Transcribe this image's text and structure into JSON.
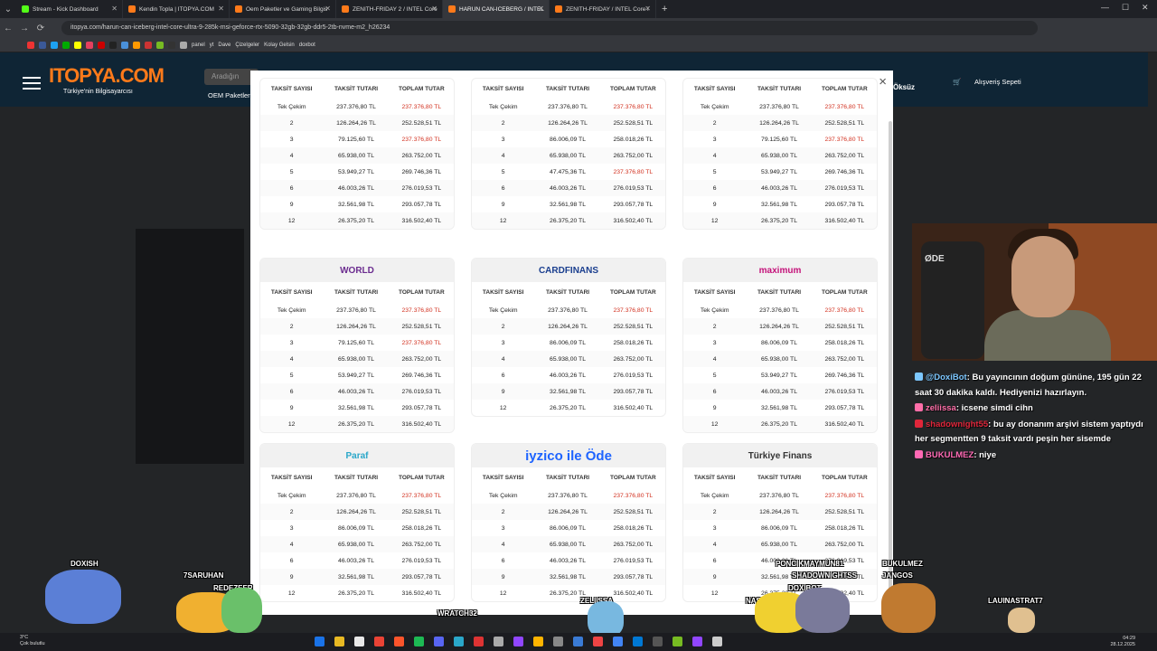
{
  "browser": {
    "tabs": [
      {
        "title": "Stream - Kick Dashboard",
        "color": "#53fc18",
        "active": false
      },
      {
        "title": "Kendin Topla | ITOPYA.COM",
        "color": "#ff7a1a",
        "active": false
      },
      {
        "title": "Oem Paketler ve Gaming Bilgis",
        "color": "#ff7a1a",
        "active": false
      },
      {
        "title": "ZENITH-FRIDAY 2 / INTEL Core",
        "color": "#ff7a1a",
        "active": false
      },
      {
        "title": "HARUN CAN-ICEBERG / INTEL",
        "color": "#ff7a1a",
        "active": true
      },
      {
        "title": "ZENITH-FRIDAY / INTEL Core i",
        "color": "#ff7a1a",
        "active": false
      }
    ],
    "url": "itopya.com/harun-can-iceberg-intel-core-ultra-9-285k-msi-geforce-rtx-5090-32gb-32gb-ddr5-2tb-nvme-m2_h26234",
    "bookmarks": [
      "panel",
      "yt",
      "Dave",
      "Çizelgeler",
      "Kolay Gelsin",
      "doxbot"
    ]
  },
  "site": {
    "logo": "ITOPYA.COM",
    "slogan": "Türkiye'nin Bilgisayarcısı",
    "search_placeholder": "Aradığın",
    "oem_label": "OEM Paketler",
    "user_label": "Öksüz",
    "cart_count": "0",
    "cart_label": "Alışveriş Sepeti"
  },
  "modal": {
    "close_label": "×",
    "headers": {
      "count": "TAKSİT SAYISI",
      "installment": "TAKSİT TUTARI",
      "total": "TOPLAM TUTAR"
    },
    "cards": [
      {
        "bank": "",
        "brand_color": "#333",
        "rows": [
          [
            "Tek Çekim",
            "237.376,80 TL",
            "237.376,80 TL",
            true
          ],
          [
            "2",
            "126.264,26 TL",
            "252.528,51 TL",
            false
          ],
          [
            "3",
            "79.125,60 TL",
            "237.376,80 TL",
            true
          ],
          [
            "4",
            "65.938,00 TL",
            "263.752,00 TL",
            false
          ],
          [
            "5",
            "53.949,27 TL",
            "269.746,36 TL",
            false
          ],
          [
            "6",
            "46.003,26 TL",
            "276.019,53 TL",
            false
          ],
          [
            "9",
            "32.561,98 TL",
            "293.057,78 TL",
            false
          ],
          [
            "12",
            "26.375,20 TL",
            "316.502,40 TL",
            false
          ]
        ]
      },
      {
        "bank": "",
        "brand_color": "#333",
        "rows": [
          [
            "Tek Çekim",
            "237.376,80 TL",
            "237.376,80 TL",
            true
          ],
          [
            "2",
            "126.264,26 TL",
            "252.528,51 TL",
            false
          ],
          [
            "3",
            "86.006,09 TL",
            "258.018,26 TL",
            false
          ],
          [
            "4",
            "65.938,00 TL",
            "263.752,00 TL",
            false
          ],
          [
            "5",
            "47.475,36 TL",
            "237.376,80 TL",
            true
          ],
          [
            "6",
            "46.003,26 TL",
            "276.019,53 TL",
            false
          ],
          [
            "9",
            "32.561,98 TL",
            "293.057,78 TL",
            false
          ],
          [
            "12",
            "26.375,20 TL",
            "316.502,40 TL",
            false
          ]
        ]
      },
      {
        "bank": "",
        "brand_color": "#333",
        "rows": [
          [
            "Tek Çekim",
            "237.376,80 TL",
            "237.376,80 TL",
            true
          ],
          [
            "2",
            "126.264,26 TL",
            "252.528,51 TL",
            false
          ],
          [
            "3",
            "79.125,60 TL",
            "237.376,80 TL",
            true
          ],
          [
            "4",
            "65.938,00 TL",
            "263.752,00 TL",
            false
          ],
          [
            "5",
            "53.949,27 TL",
            "269.746,36 TL",
            false
          ],
          [
            "6",
            "46.003,26 TL",
            "276.019,53 TL",
            false
          ],
          [
            "9",
            "32.561,98 TL",
            "293.057,78 TL",
            false
          ],
          [
            "12",
            "26.375,20 TL",
            "316.502,40 TL",
            false
          ]
        ]
      },
      {
        "bank": "WORLD",
        "brand_color": "#6b2c8f",
        "rows": [
          [
            "Tek Çekim",
            "237.376,80 TL",
            "237.376,80 TL",
            true
          ],
          [
            "2",
            "126.264,26 TL",
            "252.528,51 TL",
            false
          ],
          [
            "3",
            "79.125,60 TL",
            "237.376,80 TL",
            true
          ],
          [
            "4",
            "65.938,00 TL",
            "263.752,00 TL",
            false
          ],
          [
            "5",
            "53.949,27 TL",
            "269.746,36 TL",
            false
          ],
          [
            "6",
            "46.003,26 TL",
            "276.019,53 TL",
            false
          ],
          [
            "9",
            "32.561,98 TL",
            "293.057,78 TL",
            false
          ],
          [
            "12",
            "26.375,20 TL",
            "316.502,40 TL",
            false
          ]
        ]
      },
      {
        "bank": "CARDFINANS",
        "brand_color": "#1b3f8f",
        "rows": [
          [
            "Tek Çekim",
            "237.376,80 TL",
            "237.376,80 TL",
            true
          ],
          [
            "2",
            "126.264,26 TL",
            "252.528,51 TL",
            false
          ],
          [
            "3",
            "86.006,09 TL",
            "258.018,26 TL",
            false
          ],
          [
            "4",
            "65.938,00 TL",
            "263.752,00 TL",
            false
          ],
          [
            "6",
            "46.003,26 TL",
            "276.019,53 TL",
            false
          ],
          [
            "9",
            "32.561,98 TL",
            "293.057,78 TL",
            false
          ],
          [
            "12",
            "26.375,20 TL",
            "316.502,40 TL",
            false
          ]
        ]
      },
      {
        "bank": "maximum",
        "brand_color": "#c4127a",
        "rows": [
          [
            "Tek Çekim",
            "237.376,80 TL",
            "237.376,80 TL",
            true
          ],
          [
            "2",
            "126.264,26 TL",
            "252.528,51 TL",
            false
          ],
          [
            "3",
            "86.006,09 TL",
            "258.018,26 TL",
            false
          ],
          [
            "4",
            "65.938,00 TL",
            "263.752,00 TL",
            false
          ],
          [
            "5",
            "53.949,27 TL",
            "269.746,36 TL",
            false
          ],
          [
            "6",
            "46.003,26 TL",
            "276.019,53 TL",
            false
          ],
          [
            "9",
            "32.561,98 TL",
            "293.057,78 TL",
            false
          ],
          [
            "12",
            "26.375,20 TL",
            "316.502,40 TL",
            false
          ]
        ]
      },
      {
        "bank": "Paraf",
        "brand_color": "#2aa7c9",
        "rows": [
          [
            "Tek Çekim",
            "237.376,80 TL",
            "237.376,80 TL",
            true
          ],
          [
            "2",
            "126.264,26 TL",
            "252.528,51 TL",
            false
          ],
          [
            "3",
            "86.006,09 TL",
            "258.018,26 TL",
            false
          ],
          [
            "4",
            "65.938,00 TL",
            "263.752,00 TL",
            false
          ],
          [
            "6",
            "46.003,26 TL",
            "276.019,53 TL",
            false
          ],
          [
            "9",
            "32.561,98 TL",
            "293.057,78 TL",
            false
          ],
          [
            "12",
            "26.375,20 TL",
            "316.502,40 TL",
            false
          ]
        ]
      },
      {
        "bank": "iyzico ile Öde",
        "brand_color": "#1e64ff",
        "rows": [
          [
            "Tek Çekim",
            "237.376,80 TL",
            "237.376,80 TL",
            true
          ],
          [
            "2",
            "126.264,26 TL",
            "252.528,51 TL",
            false
          ],
          [
            "3",
            "86.006,09 TL",
            "258.018,26 TL",
            false
          ],
          [
            "4",
            "65.938,00 TL",
            "263.752,00 TL",
            false
          ],
          [
            "6",
            "46.003,26 TL",
            "276.019,53 TL",
            false
          ],
          [
            "9",
            "32.561,98 TL",
            "293.057,78 TL",
            false
          ],
          [
            "12",
            "26.375,20 TL",
            "316.502,40 TL",
            false
          ]
        ]
      },
      {
        "bank": "Türkiye Finans",
        "brand_color": "#333",
        "rows": [
          [
            "Tek Çekim",
            "237.376,80 TL",
            "237.376,80 TL",
            true
          ],
          [
            "2",
            "126.264,26 TL",
            "252.528,51 TL",
            false
          ],
          [
            "3",
            "86.006,09 TL",
            "258.018,26 TL",
            false
          ],
          [
            "4",
            "65.938,00 TL",
            "263.752,00 TL",
            false
          ],
          [
            "6",
            "46.003,26 TL",
            "276.019,53 TL",
            false
          ],
          [
            "9",
            "32.561,98 TL",
            "293.057,78 TL",
            false
          ],
          [
            "12",
            "26.375,20 TL",
            "316.502,40 TL",
            false
          ]
        ]
      }
    ]
  },
  "stream": {
    "chair_text": "ØDE",
    "chat": [
      {
        "user": "@DoxiBot",
        "user_color": "#7cc7ff",
        "text": ": Bu yayıncının doğum gününe, 195 gün 22 saat 30 dakika kaldı. Hediyenizi hazırlayın."
      },
      {
        "user": "zeliissa",
        "user_color": "#ff6ea8",
        "text": ": icsene simdi cihn"
      },
      {
        "user": "shadownight55",
        "user_color": "#e0263a",
        "text": ": bu ay donanım arşivi sistem yaptıydı her segmentten 9 taksit vardı peşin her sisemde"
      },
      {
        "user": "BUKULMEZ",
        "user_color": "#ff69b4",
        "text": ": niye"
      }
    ],
    "overlay_names": [
      "DOXISH",
      "7SARUHAN",
      "REDEZEER",
      "WRATCH32",
      "ZELIISSA",
      "PONCIKMAYMUN81",
      "SHADOWNIGHTSS",
      "DOXIBOT",
      "NASATAIS",
      "BUKULMEZ",
      "JANGOS",
      "LAUINASTRAT7"
    ]
  },
  "taskbar": {
    "weather_temp": "3°C",
    "weather_desc": "Çok bulutlu",
    "time": "04:29",
    "date": "28.12.2025"
  }
}
